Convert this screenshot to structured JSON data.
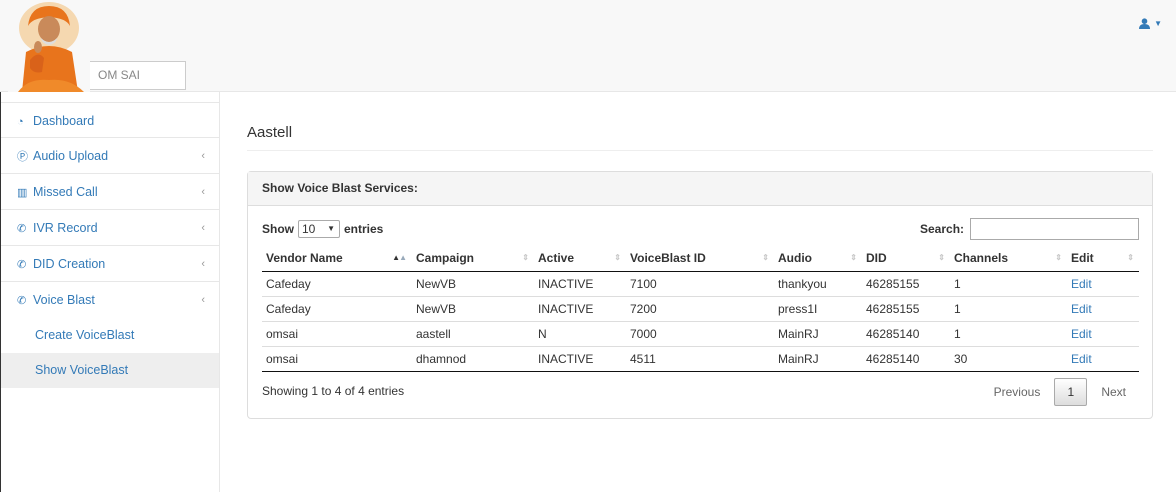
{
  "header": {
    "brand_label": "OM SAI",
    "user_icon": "user-icon",
    "caret_icon": "caret-down-icon"
  },
  "sidebar": {
    "items": [
      {
        "label": "Dashboard",
        "icon": "dashboard-icon"
      },
      {
        "label": "Audio Upload",
        "icon": "audio-icon"
      },
      {
        "label": "Missed Call",
        "icon": "bar-chart-icon"
      },
      {
        "label": "IVR Record",
        "icon": "phone-icon"
      },
      {
        "label": "DID Creation",
        "icon": "phone-icon"
      },
      {
        "label": "Voice Blast",
        "icon": "phone-icon"
      }
    ],
    "sub_items": [
      {
        "label": "Create VoiceBlast"
      },
      {
        "label": "Show VoiceBlast"
      }
    ]
  },
  "page": {
    "title": "Aastell"
  },
  "panel": {
    "heading": "Show Voice Blast Services:",
    "show_label": "Show",
    "entries_label": "entries",
    "page_length": "10",
    "search_label": "Search:",
    "search_value": "",
    "columns": [
      "Vendor Name",
      "Campaign",
      "Active",
      "VoiceBlast ID",
      "Audio",
      "DID",
      "Channels",
      "Edit"
    ],
    "rows": [
      {
        "vendor": "Cafeday",
        "campaign": "NewVB",
        "active": "INACTIVE",
        "id": "7100",
        "audio": "thankyou",
        "did": "46285155",
        "channels": "1",
        "edit": "Edit"
      },
      {
        "vendor": "Cafeday",
        "campaign": "NewVB",
        "active": "INACTIVE",
        "id": "7200",
        "audio": "press1I",
        "did": "46285155",
        "channels": "1",
        "edit": "Edit"
      },
      {
        "vendor": "omsai",
        "campaign": "aastell",
        "active": "N",
        "id": "7000",
        "audio": "MainRJ",
        "did": "46285140",
        "channels": "1",
        "edit": "Edit"
      },
      {
        "vendor": "omsai",
        "campaign": "dhamnod",
        "active": "INACTIVE",
        "id": "4511",
        "audio": "MainRJ",
        "did": "46285140",
        "channels": "30",
        "edit": "Edit"
      }
    ],
    "info": "Showing 1 to 4 of 4 entries",
    "pagination": {
      "previous": "Previous",
      "current": "1",
      "next": "Next"
    }
  },
  "colors": {
    "link": "#337ab7",
    "accent_orange": "#e8741c"
  }
}
